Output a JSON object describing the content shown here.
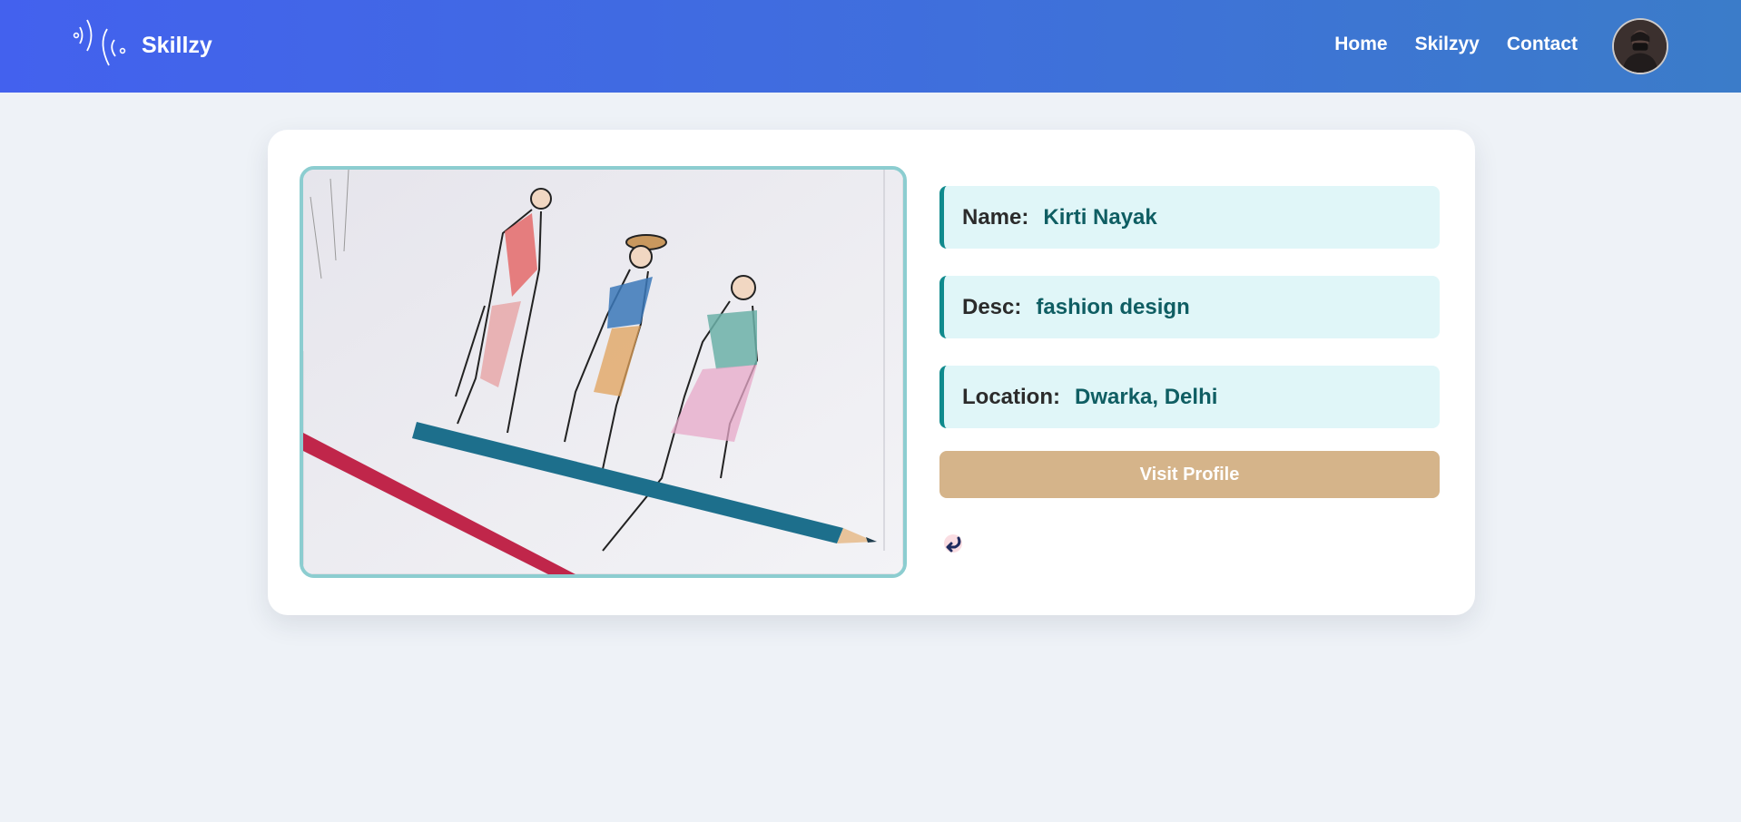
{
  "brand": {
    "name": "Skillzy",
    "logo_icon": "sound-waves-icon"
  },
  "nav": {
    "links": [
      {
        "label": "Home"
      },
      {
        "label": "Skilzyy"
      },
      {
        "label": "Contact"
      }
    ],
    "avatar_icon": "user-avatar"
  },
  "profile": {
    "image": "fashion-sketch-image",
    "fields": [
      {
        "label": "Name:",
        "value": "Kirti Nayak"
      },
      {
        "label": "Desc:",
        "value": "fashion design"
      },
      {
        "label": "Location:",
        "value": "Dwarka, Delhi"
      }
    ],
    "visit_label": "Visit Profile",
    "back_icon": "back-arrow-icon"
  },
  "colors": {
    "navbar_start": "#4361ee",
    "navbar_end": "#3b7cc9",
    "field_bg": "#e0f6f8",
    "field_accent": "#0f8a8d",
    "button": "#d5b48a",
    "frame_border": "#8ccdd0"
  }
}
